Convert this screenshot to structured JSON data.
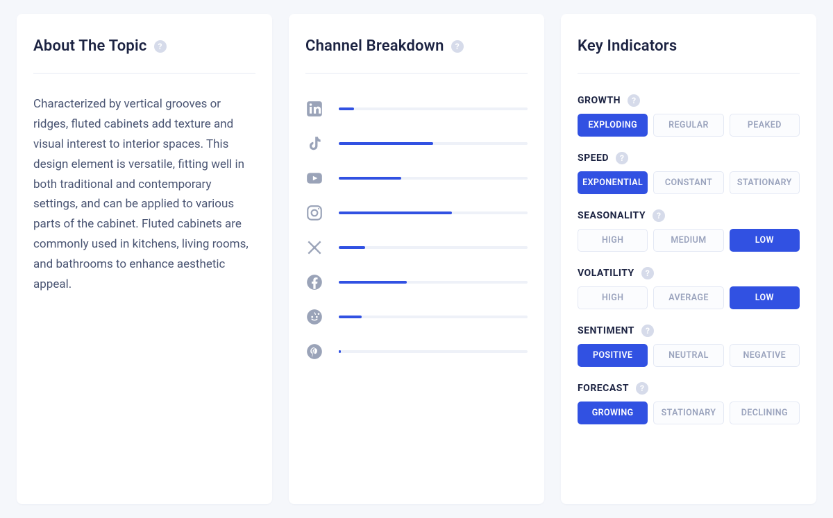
{
  "about": {
    "title": "About The Topic",
    "text": "Characterized by vertical grooves or ridges, fluted cabinets add texture and visual interest to interior spaces. This design element is versatile, fitting well in both traditional and contemporary settings, and can be applied to various parts of the cabinet. Fluted cabinets are commonly used in kitchens, living rooms, and bathrooms to enhance aesthetic appeal."
  },
  "channel": {
    "title": "Channel Breakdown",
    "items": [
      {
        "name": "linkedin",
        "pct": 8
      },
      {
        "name": "tiktok",
        "pct": 50
      },
      {
        "name": "youtube",
        "pct": 33
      },
      {
        "name": "instagram",
        "pct": 60
      },
      {
        "name": "x",
        "pct": 14
      },
      {
        "name": "facebook",
        "pct": 36
      },
      {
        "name": "reddit",
        "pct": 12
      },
      {
        "name": "pinterest",
        "pct": 1
      }
    ]
  },
  "indicators": {
    "title": "Key Indicators",
    "groups": [
      {
        "name": "GROWTH",
        "options": [
          "EXPLODING",
          "REGULAR",
          "PEAKED"
        ],
        "active": 0
      },
      {
        "name": "SPEED",
        "options": [
          "EXPONENTIAL",
          "CONSTANT",
          "STATIONARY"
        ],
        "active": 0
      },
      {
        "name": "SEASONALITY",
        "options": [
          "HIGH",
          "MEDIUM",
          "LOW"
        ],
        "active": 2
      },
      {
        "name": "VOLATILITY",
        "options": [
          "HIGH",
          "AVERAGE",
          "LOW"
        ],
        "active": 2
      },
      {
        "name": "SENTIMENT",
        "options": [
          "POSITIVE",
          "NEUTRAL",
          "NEGATIVE"
        ],
        "active": 0
      },
      {
        "name": "FORECAST",
        "options": [
          "GROWING",
          "STATIONARY",
          "DECLINING"
        ],
        "active": 0
      }
    ]
  }
}
